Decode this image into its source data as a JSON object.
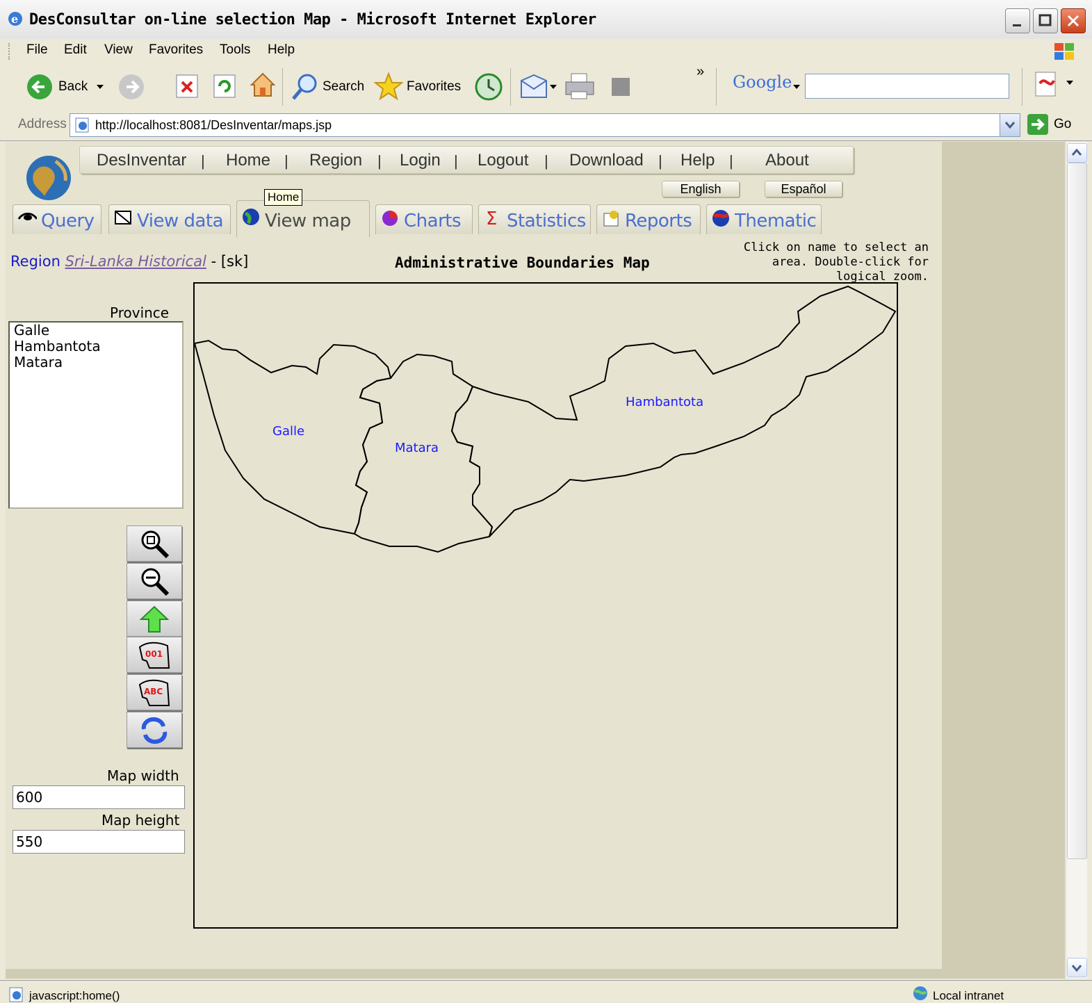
{
  "window": {
    "title": "DesConsultar on-line selection Map - Microsoft Internet Explorer"
  },
  "menu": [
    "File",
    "Edit",
    "View",
    "Favorites",
    "Tools",
    "Help"
  ],
  "toolbar": {
    "back_label": "Back",
    "search_label": "Search",
    "favorites_label": "Favorites",
    "google_label": "Google",
    "chevron": "»"
  },
  "address": {
    "label": "Address",
    "url": "http://localhost:8081/DesInventar/maps.jsp",
    "go_label": "Go"
  },
  "nav": {
    "items": [
      "DesInventar",
      "Home",
      "Region",
      "Login",
      "Logout",
      "Download",
      "Help",
      "About"
    ],
    "languages": [
      "English",
      "Español"
    ],
    "tooltip": "Home"
  },
  "tabs": [
    "Query",
    "View data",
    "View map",
    "Charts",
    "Statistics",
    "Reports",
    "Thematic"
  ],
  "region": {
    "label": "Region",
    "name": "Sri-Lanka Historical",
    "code": "- [sk]"
  },
  "map": {
    "title": "Administrative Boundaries Map",
    "hint": "Click on name to select an area. Double-click for logical zoom.",
    "areas": [
      "Galle",
      "Matara",
      "Hambantota"
    ]
  },
  "sidebar": {
    "province_label": "Province",
    "provinces": [
      "Galle",
      "Hambantota",
      "Matara"
    ],
    "map_width_label": "Map width",
    "map_width": "600",
    "map_height_label": "Map height",
    "map_height": "550",
    "tool_codes": [
      "001",
      "ABC"
    ]
  },
  "status": {
    "text": "javascript:home()",
    "zone": "Local intranet"
  }
}
